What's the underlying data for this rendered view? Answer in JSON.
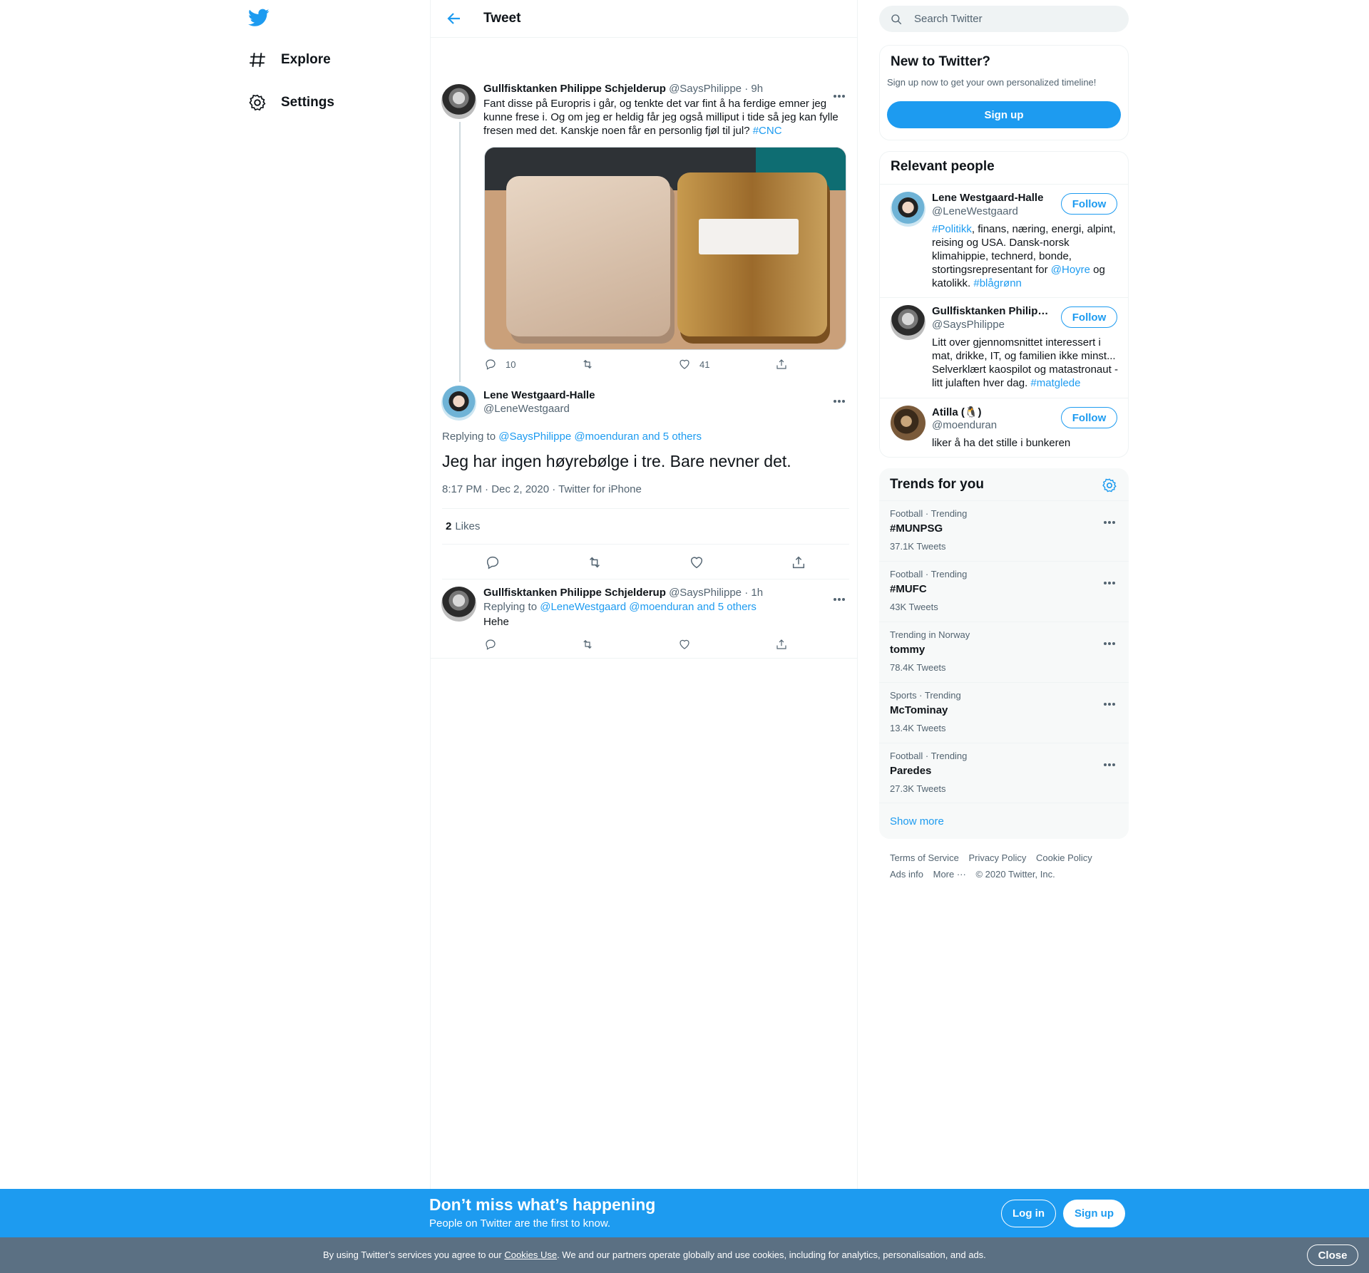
{
  "nav": {
    "logo_icon": "twitter-bird-icon",
    "items": [
      {
        "label": "Explore",
        "icon": "hash-icon"
      },
      {
        "label": "Settings",
        "icon": "gear-icon"
      }
    ]
  },
  "header": {
    "title": "Tweet"
  },
  "tweet1": {
    "name": "Gullfisktanken Philippe Schjelderup",
    "handle": "@SaysPhilippe",
    "time": "9h",
    "text": "Fant disse på Europris i går, og tenkte det var fint å ha ferdige emner jeg kunne frese i. Og om jeg er heldig får jeg også milliput i tide så jeg kan fylle fresen med det. Kanskje noen får en personlig fjøl til jul?",
    "hashtag": "#CNC",
    "replies": "10",
    "likes": "41"
  },
  "tweet2": {
    "name": "Lene Westgaard-Halle",
    "handle": "@LeneWestgaard",
    "replying_prefix": "Replying to",
    "replying_to": "@SaysPhilippe @moenduran and 5 others",
    "text": "Jeg har ingen høyrebølge i tre. Bare nevner det.",
    "timestamp": "8:17 PM · Dec 2, 2020 · Twitter for iPhone",
    "likes_count": "2",
    "likes_label": "Likes"
  },
  "tweet3": {
    "name": "Gullfisktanken Philippe Schjelderup",
    "handle": "@SaysPhilippe",
    "time": "1h",
    "replying_prefix": "Replying to",
    "replying_to": "@LeneWestgaard @moenduran and 5 others",
    "text": "Hehe"
  },
  "search": {
    "placeholder": "Search Twitter"
  },
  "new_to_twitter": {
    "title": "New to Twitter?",
    "subtitle": "Sign up now to get your own personalized timeline!",
    "button": "Sign up"
  },
  "relevant_people": {
    "title": "Relevant people",
    "follow_label": "Follow",
    "people": [
      {
        "name": "Lene Westgaard-Halle",
        "handle": "@LeneWestgaard",
        "bio_parts": [
          "#Politikk",
          ", finans, næring, energi, alpint, reising og USA. Dansk-norsk klimahippie, technerd, bonde, stortingsrepresentant for ",
          "@Hoyre",
          " og katolikk. ",
          "#blågrønn"
        ]
      },
      {
        "name": "Gullfisktanken Philip…",
        "handle": "@SaysPhilippe",
        "bio_parts": [
          "Litt over gjennomsnittet interessert i mat, drikke, IT, og familien ikke minst... Selverklært kaospilot og matastronaut -litt julaften hver dag. ",
          "#matglede"
        ]
      },
      {
        "name": "Atilla (🐧)",
        "handle": "@moenduran",
        "bio_parts": [
          "liker å ha det stille i bunkeren"
        ]
      }
    ]
  },
  "trends": {
    "title": "Trends for you",
    "items": [
      {
        "category": "Football · Trending",
        "name": "#MUNPSG",
        "count": "37.1K Tweets"
      },
      {
        "category": "Football · Trending",
        "name": "#MUFC",
        "count": "43K Tweets"
      },
      {
        "category": "Trending in Norway",
        "name": "tommy",
        "count": "78.4K Tweets"
      },
      {
        "category": "Sports · Trending",
        "name": "McTominay",
        "count": "13.4K Tweets"
      },
      {
        "category": "Football · Trending",
        "name": "Paredes",
        "count": "27.3K Tweets"
      }
    ],
    "show_more": "Show more"
  },
  "footer": {
    "links": [
      "Terms of Service",
      "Privacy Policy",
      "Cookie Policy",
      "Ads info",
      "More ···",
      "© 2020 Twitter, Inc."
    ]
  },
  "banner": {
    "headline": "Don’t miss what’s happening",
    "subline": "People on Twitter are the first to know.",
    "login": "Log in",
    "signup": "Sign up"
  },
  "cookie": {
    "prefix": "By using Twitter’s services you agree to our ",
    "link": "Cookies Use",
    "suffix": ". We and our partners operate globally and use cookies, including for analytics, personalisation, and ads.",
    "close": "Close"
  },
  "colors": {
    "accent": "#1d9bf0",
    "cookie_bg": "#5b7083"
  }
}
